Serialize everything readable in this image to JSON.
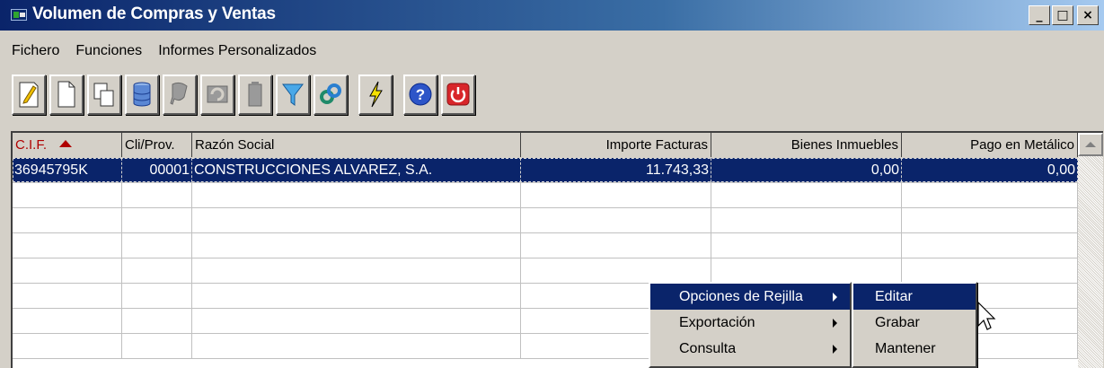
{
  "window": {
    "title": "Volumen de Compras y Ventas",
    "controls": {
      "minimize": "_",
      "maximize": "□",
      "close": "×"
    }
  },
  "menu": [
    "Fichero",
    "Funciones",
    "Informes Personalizados"
  ],
  "toolbar": {
    "buttons": [
      {
        "name": "edit-icon"
      },
      {
        "name": "new-document-icon"
      },
      {
        "name": "copy-icon"
      },
      {
        "name": "database-icon"
      },
      {
        "name": "stamp-icon"
      },
      {
        "name": "undo-icon"
      },
      {
        "name": "trash-icon"
      },
      {
        "name": "filter-icon"
      },
      {
        "name": "link-icon"
      },
      {
        "name": "lightning-icon"
      },
      {
        "name": "help-icon"
      },
      {
        "name": "power-icon"
      }
    ]
  },
  "grid": {
    "columns": [
      "C.I.F.",
      "Cli/Prov.",
      "Razón Social",
      "Importe Facturas",
      "Bienes Inmuebles",
      "Pago en Metálico"
    ],
    "sort_column": "C.I.F.",
    "sort_direction": "ascending",
    "rows": [
      {
        "cif": "36945795K",
        "cliprov": "00001",
        "razon": "CONSTRUCCIONES ALVAREZ, S.A.",
        "importe": "11.743,33",
        "bienes": "0,00",
        "pago": "0,00"
      }
    ]
  },
  "context_menu": {
    "items": [
      "Opciones de Rejilla",
      "Exportación",
      "Consulta"
    ],
    "highlighted": "Opciones de Rejilla",
    "submenu": [
      "Editar",
      "Grabar",
      "Mantener"
    ],
    "submenu_highlighted": "Editar"
  },
  "colors": {
    "selection": "#0a246a",
    "title_gradient_start": "#0a246a",
    "face": "#d4d0c8"
  }
}
